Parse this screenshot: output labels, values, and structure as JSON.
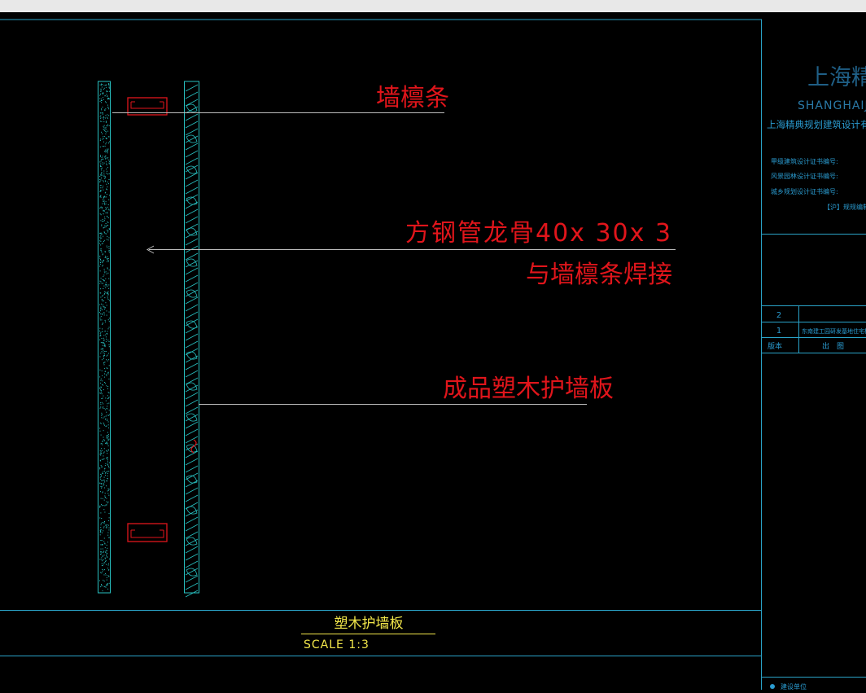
{
  "labels": {
    "purlin": "墙檩条",
    "steel_tube": "方钢管龙骨40x 30x 3",
    "weld_note": "与墙檩条焊接",
    "panel": "成品塑木护墙板"
  },
  "detail": {
    "title": "塑木护墙板",
    "scale": "SCALE 1:3"
  },
  "title_block": {
    "company_cn": "上海精典",
    "company_en": "SHANGHAIJ",
    "company_full": "上海精典规划建筑设计有限公",
    "cert_1": "甲级建筑设计证书编号:",
    "cert_2": "风景园林设计证书编号:",
    "cert_3": "城乡规划设计证书编号:",
    "cert_4": "【沪】规规编制",
    "rev_rows": [
      {
        "no": "2",
        "desc": ""
      },
      {
        "no": "1",
        "desc": "东南建工园研发基地住宅楼"
      }
    ],
    "rev_header": {
      "no": "版本",
      "desc": "出　图"
    },
    "footer": "建设单位"
  },
  "colors": {
    "background": "#000000",
    "frame": "#2aa3c8",
    "annotation": "#e0151b",
    "leader": "#bdbdbd",
    "title_text": "#f2e64a",
    "hatch": "#28c0c0",
    "topbar": "#e8e8e8"
  }
}
